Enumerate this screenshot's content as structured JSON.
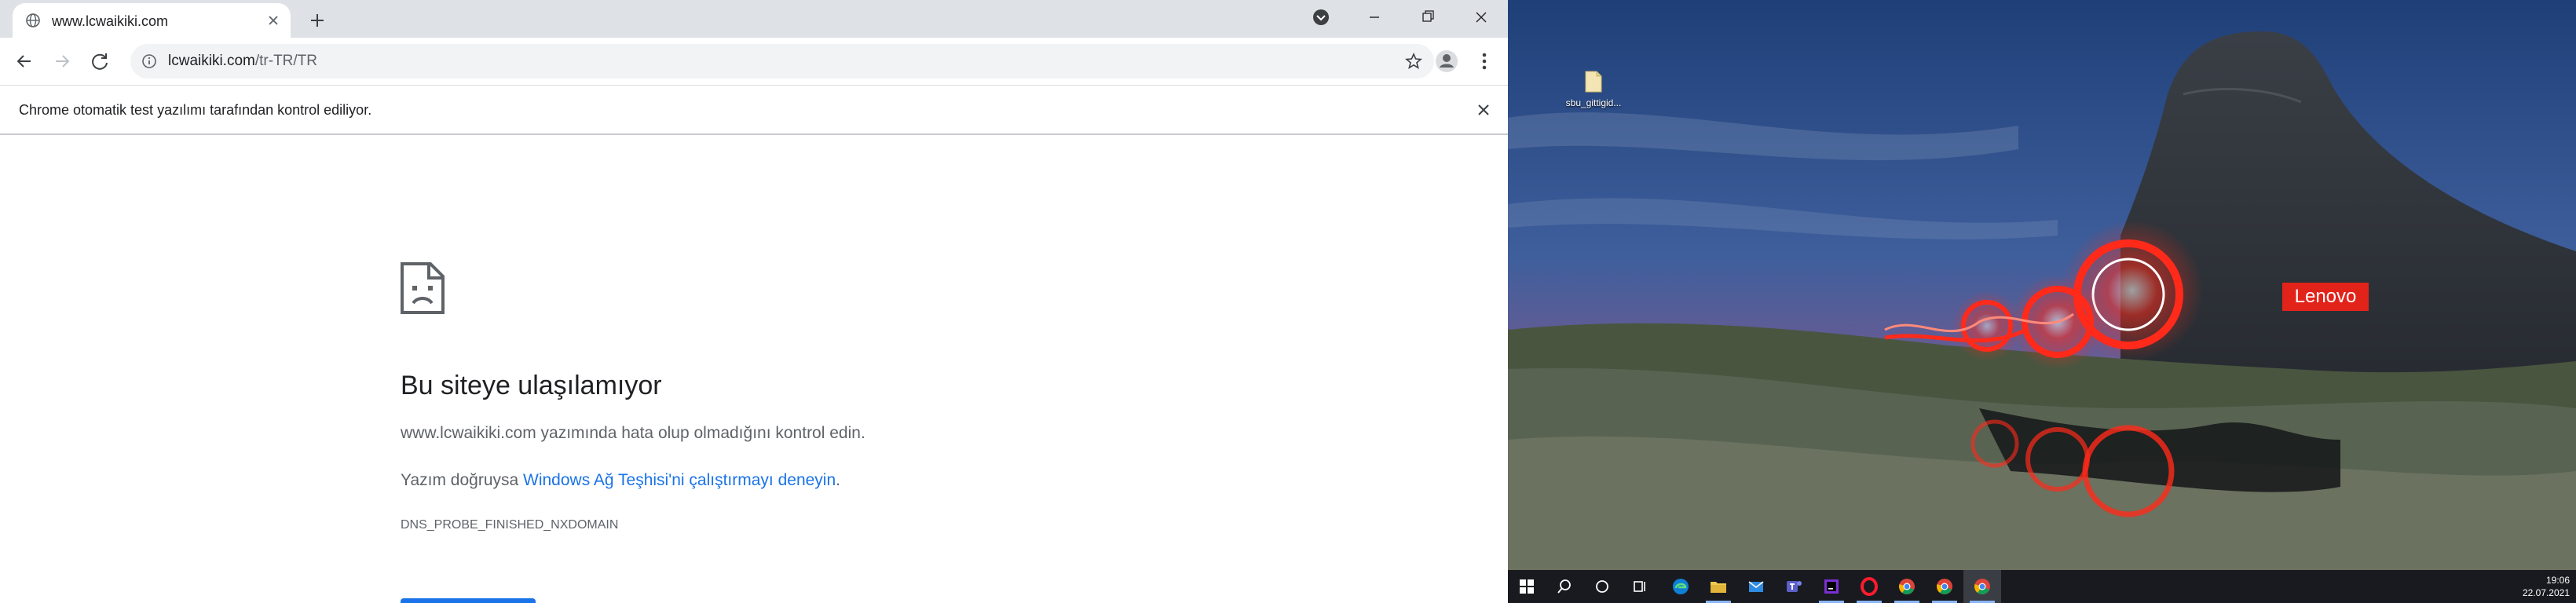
{
  "browser": {
    "tab": {
      "title": "www.lcwaikiki.com"
    },
    "omnibox": {
      "host": "lcwaikiki.com",
      "path": "/tr-TR/TR"
    },
    "infobar": {
      "message": "Chrome otomatik test yazılımı tarafından kontrol ediliyor."
    },
    "error": {
      "title": "Bu siteye ulaşılamıyor",
      "line1": "www.lcwaikiki.com yazımında hata olup olmadığını kontrol edin.",
      "line2_prefix": "Yazım doğruysa ",
      "line2_link": "Windows Ağ Teşhisi'ni çalıştırmayı deneyin",
      "line2_suffix": ".",
      "code": "DNS_PROBE_FINISHED_NXDOMAIN"
    }
  },
  "desktop": {
    "icon_label": "sbu_gittigid...",
    "brand": "Lenovo",
    "tray": {
      "time": "19:06",
      "date": "22.07.2021"
    }
  },
  "colors": {
    "link": "#1a73e8",
    "brand": "#e2231a",
    "taskbar": "#181a1f"
  },
  "icons": {
    "taskbar": [
      "windows-start-icon",
      "search-icon",
      "cortana-icon",
      "task-view-icon",
      "edge-icon",
      "file-explorer-icon",
      "mail-icon",
      "teams-icon",
      "intellij-icon",
      "opera-icon",
      "chrome-icon",
      "chrome-icon",
      "chrome-icon"
    ]
  }
}
